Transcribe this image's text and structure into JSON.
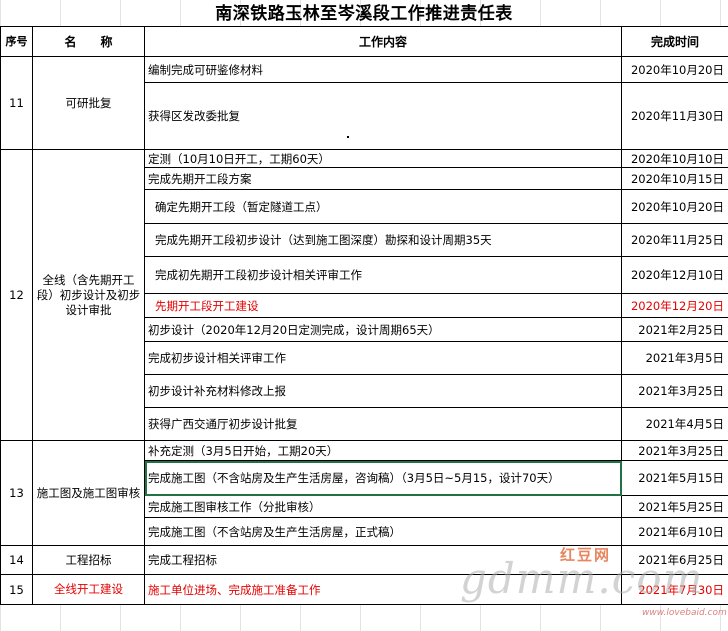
{
  "title": "南深铁路玉林至岑溪段工作推进责任表",
  "headers": {
    "no": "序号",
    "name": "名　　称",
    "task": "工作内容",
    "date": "完成时间"
  },
  "rows": [
    {
      "no": "11",
      "name": "可研批复",
      "task": "编制完成可研鉴修材料",
      "date": "2020年10月20日"
    },
    {
      "task": "获得区发改委批复",
      "date": "2020年11月30日"
    },
    {
      "no": "12",
      "name": "全线（含先期开工段）初步设计及初步设计审批",
      "task": "定测（10月10日开工，工期60天）",
      "date": "2020年10月10日"
    },
    {
      "task": "完成先期开工段方案",
      "date": "2020年10月15日"
    },
    {
      "task": "确定先期开工段（暂定隧道工点）",
      "date": "2020年10月20日"
    },
    {
      "task": "完成先期开工段初步设计（达到施工图深度）勘探和设计周期35天",
      "date": "2020年11月25日"
    },
    {
      "task": "完成初先期开工段初步设计相关评审工作",
      "date": "2020年12月10日"
    },
    {
      "task": "先期开工段开工建设",
      "date": "2020年12月20日"
    },
    {
      "task": "初步设计（2020年12月20日定测完成，设计周期65天）",
      "date": "2021年2月25日"
    },
    {
      "task": "完成初步设计相关评审工作",
      "date": "2021年3月5日"
    },
    {
      "task": "初步设计补充材料修改上报",
      "date": "2021年3月25日"
    },
    {
      "task": "获得广西交通厅初步设计批复",
      "date": "2021年4月5日"
    },
    {
      "no": "13",
      "name": "施工图及施工图审核",
      "task": "补充定测（3月5日开始，工期20天）",
      "date": "2021年3月25日"
    },
    {
      "task": "完成施工图（不含站房及生产生活房屋，咨询稿）（3月5日~5月15，设计70天）",
      "date": "2021年5月15日"
    },
    {
      "task": "完成施工图审核工作（分批审核）",
      "date": "2021年5月25日"
    },
    {
      "task": "完成施工图（不含站房及生产生活房屋，正式稿）",
      "date": "2021年6月10日"
    },
    {
      "no": "14",
      "name": "工程招标",
      "task": "完成工程招标",
      "date": "2021年6月25日"
    },
    {
      "no": "15",
      "name": "全线开工建设",
      "task": "施工单位进场、完成施工准备工作",
      "date": "2021年7月30日"
    }
  ],
  "watermark": {
    "main": "gdmm.com",
    "cn": "红豆网",
    "url": "www.lovebaid.com"
  }
}
